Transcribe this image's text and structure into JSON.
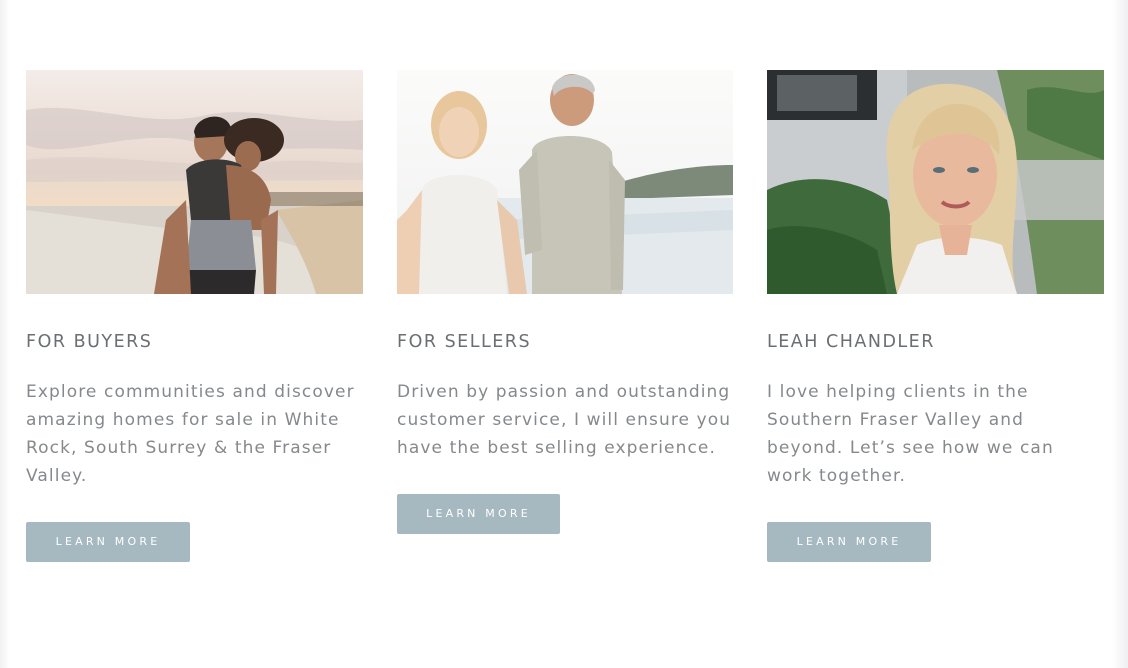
{
  "cards": [
    {
      "title": "FOR BUYERS",
      "text": "Explore communities and discover amazing homes for sale in White Rock, South Surrey & the Fraser Valley.",
      "button_label": "LEARN MORE"
    },
    {
      "title": "FOR SELLERS",
      "text": "Driven by passion and outstanding customer service, I will ensure you have the best selling experience.",
      "button_label": "LEARN MORE"
    },
    {
      "title": "LEAH CHANDLER",
      "text": "I love helping clients in the Southern Fraser Valley and beyond. Let’s see how we can work together.",
      "button_label": "LEARN MORE"
    }
  ],
  "colors": {
    "button_bg": "#a6b9c1",
    "title_text": "#6b6f72",
    "body_text": "#85898c"
  }
}
